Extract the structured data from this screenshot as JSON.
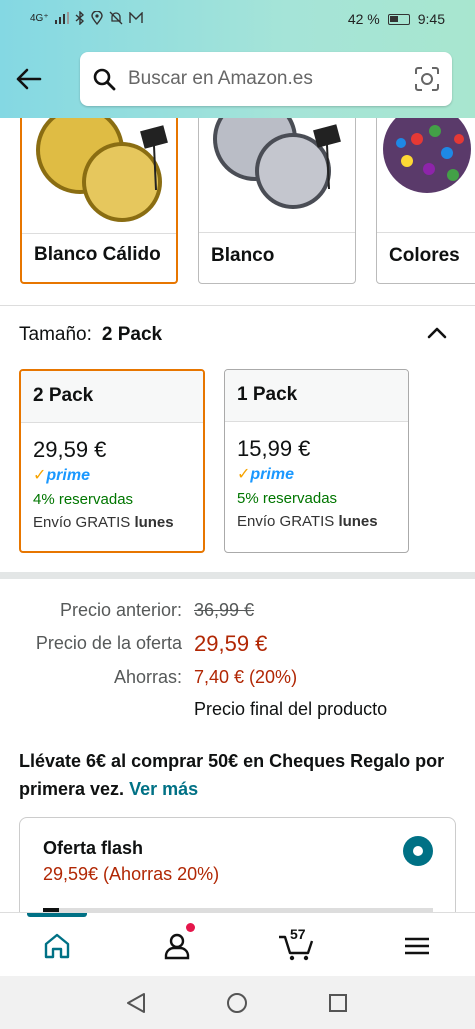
{
  "status_bar": {
    "network": "4G⁺",
    "battery": "42 %",
    "time": "9:45"
  },
  "search": {
    "placeholder": "Buscar en Amazon.es"
  },
  "color_options": [
    {
      "label": "Blanco Cálido",
      "selected": true
    },
    {
      "label": "Blanco",
      "selected": false
    },
    {
      "label": "Colores",
      "selected": false
    }
  ],
  "size": {
    "label": "Tamaño:",
    "selected": "2 Pack",
    "options": [
      {
        "name": "2 Pack",
        "price": "29,59 €",
        "prime": "prime",
        "reserved": "4% reservadas",
        "shipping": "Envío GRATIS",
        "ship_day": "lunes",
        "selected": true
      },
      {
        "name": "1 Pack",
        "price": "15,99 €",
        "prime": "prime",
        "reserved": "5% reservadas",
        "shipping": "Envío GRATIS",
        "ship_day": "lunes",
        "selected": false
      }
    ]
  },
  "pricing": {
    "previous_label": "Precio anterior:",
    "previous_value": "36,99 €",
    "deal_label": "Precio de la oferta",
    "deal_value": "29,59 €",
    "savings_label": "Ahorras:",
    "savings_value": "7,40 € (20%)",
    "final_note": "Precio final del producto"
  },
  "promo": {
    "text": "Llévate 6€ al comprar 50€ en Cheques Regalo por primera vez.",
    "link": "Ver más"
  },
  "flash_deal": {
    "title": "Oferta flash",
    "price": "29,59€ (Ahorras 20%)",
    "claimed_fraction": 0.04
  },
  "bottom_nav": {
    "cart_count": "57"
  },
  "colors": {
    "accent": "#007185",
    "selected_border": "#e77600",
    "price_red": "#b12704",
    "prime_blue": "#1a98ff",
    "green": "#007600"
  }
}
